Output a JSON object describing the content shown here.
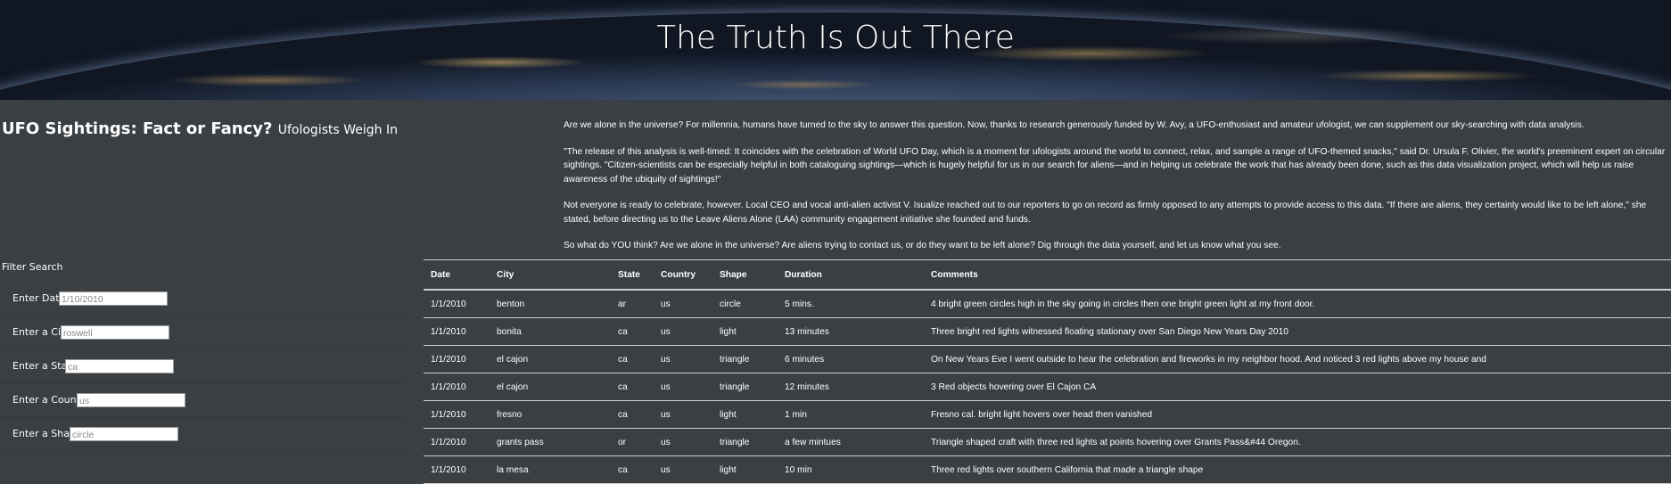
{
  "hero": {
    "title": "The Truth Is Out There"
  },
  "headline": {
    "main": "UFO Sightings: Fact or Fancy?",
    "sub": "Ufologists Weigh In"
  },
  "intro": [
    "Are we alone in the universe? For millennia, humans have turned to the sky to answer this question. Now, thanks to research generously funded by W. Avy, a UFO-enthusiast and amateur ufologist, we can supplement our sky-searching with data analysis.",
    "\"The release of this analysis is well-timed: It coincides with the celebration of World UFO Day, which is a moment for ufologists around the world to connect, relax, and sample a range of UFO-themed snacks,\" said Dr. Ursula F. Olivier, the world's preeminent expert on circular sightings. \"Citizen-scientists can be especially helpful in both cataloguing sightings—which is hugely helpful for us in our search for aliens—and in helping us celebrate the work that has already been done, such as this data visualization project, which will help us raise awareness of the ubiquity of sightings!\"",
    "Not everyone is ready to celebrate, however. Local CEO and vocal anti-alien activist V. Isualize reached out to our reporters to go on record as firmly opposed to any attempts to provide access to this data. \"If there are aliens, they certainly would like to be left alone,\" she stated, before directing us to the Leave Aliens Alone (LAA) community engagement initiative she founded and funds.",
    "So what do YOU think? Are we alone in the universe? Are aliens trying to contact us, or do they want to be left alone? Dig through the data yourself, and let us know what you see."
  ],
  "filter": {
    "title": "Filter Search",
    "fields": [
      {
        "label": "Enter Date",
        "placeholder": "1/10/2010"
      },
      {
        "label": "Enter a City",
        "placeholder": "roswell"
      },
      {
        "label": "Enter a State",
        "placeholder": "ca"
      },
      {
        "label": "Enter a Country",
        "placeholder": "us"
      },
      {
        "label": "Enter a Shape",
        "placeholder": "circle"
      }
    ]
  },
  "table": {
    "headers": [
      "Date",
      "City",
      "State",
      "Country",
      "Shape",
      "Duration",
      "Comments"
    ],
    "rows": [
      [
        "1/1/2010",
        "benton",
        "ar",
        "us",
        "circle",
        "5 mins.",
        "4 bright green circles high in the sky going in circles then one bright green light at my front door."
      ],
      [
        "1/1/2010",
        "bonita",
        "ca",
        "us",
        "light",
        "13 minutes",
        "Three bright red lights witnessed floating stationary over San Diego New Years Day 2010"
      ],
      [
        "1/1/2010",
        "el cajon",
        "ca",
        "us",
        "triangle",
        "6 minutes",
        "On New Years Eve I went outside to hear the celebration and fireworks in my neighbor hood. And noticed 3 red lights above my house and"
      ],
      [
        "1/1/2010",
        "el cajon",
        "ca",
        "us",
        "triangle",
        "12 minutes",
        "3 Red objects hovering over El Cajon CA"
      ],
      [
        "1/1/2010",
        "fresno",
        "ca",
        "us",
        "light",
        "1 min",
        "Fresno cal. bright light hovers over head then vanished"
      ],
      [
        "1/1/2010",
        "grants pass",
        "or",
        "us",
        "triangle",
        "a few mintues",
        "Triangle shaped craft with three red lights at points hovering over Grants Pass&#44 Oregon."
      ],
      [
        "1/1/2010",
        "la mesa",
        "ca",
        "us",
        "light",
        "10 min",
        "Three red lights over southern California that made a triangle shape"
      ]
    ]
  }
}
